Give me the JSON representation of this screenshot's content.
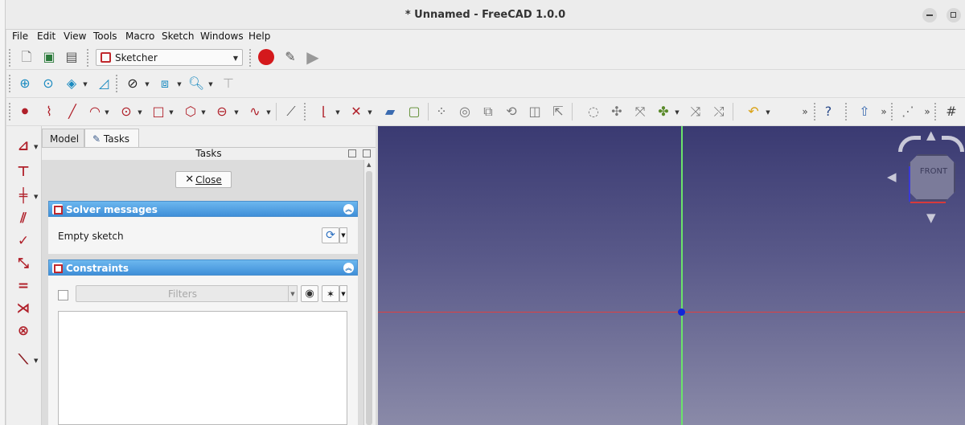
{
  "window": {
    "title": "* Unnamed - FreeCAD 1.0.0"
  },
  "menu": [
    "File",
    "Edit",
    "View",
    "Tools",
    "Macro",
    "Sketch",
    "Windows",
    "Help"
  ],
  "toolbar": {
    "workbench": "Sketcher"
  },
  "combo": {
    "tabs": {
      "model": "Model",
      "tasks": "Tasks"
    },
    "header": "Tasks",
    "close_label": "Close",
    "solver": {
      "title": "Solver messages",
      "message": "Empty sketch"
    },
    "constraints": {
      "title": "Constraints",
      "filter_placeholder": "Filters"
    }
  },
  "navcube": {
    "face": "FRONT"
  },
  "colors": {
    "accent_blue": "#3f8fd8",
    "sketch_red": "#b0202a",
    "axis_x": "#e0403e",
    "axis_y": "#6be36b",
    "origin": "#1226d8"
  }
}
